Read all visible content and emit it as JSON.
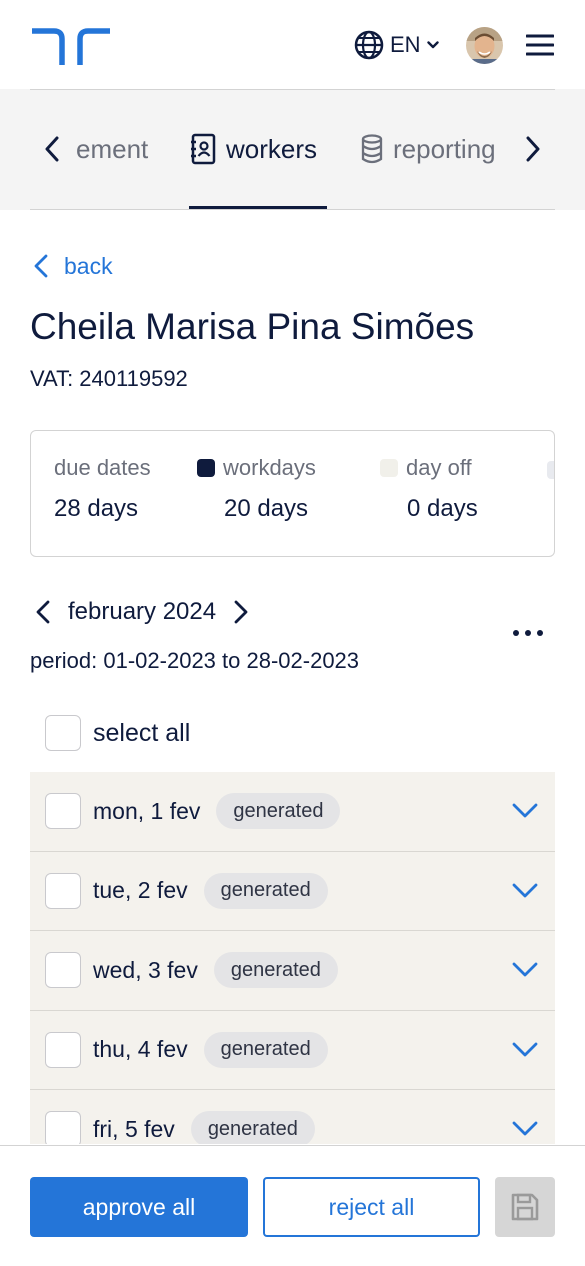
{
  "header": {
    "logo": "brand-logo",
    "language": "EN",
    "icons": {
      "globe": "globe-icon",
      "chevron": "chevron-down-icon",
      "menu": "hamburger-menu-icon"
    }
  },
  "tabs": {
    "items": [
      {
        "label": "ement",
        "icon": ""
      },
      {
        "label": "workers",
        "icon": "contacts-book-icon"
      },
      {
        "label": "reporting",
        "icon": "database-icon"
      }
    ],
    "active_index": 1
  },
  "page": {
    "back_label": "back",
    "worker_name": "Cheila Marisa Pina Simões",
    "vat": "VAT: 240119592"
  },
  "summary": {
    "items": [
      {
        "label": "due dates",
        "value": "28 days",
        "color": ""
      },
      {
        "label": "workdays",
        "value": "20 days",
        "color": "#0f1b3d"
      },
      {
        "label": "day off",
        "value": "0 days",
        "color": "#f1f0ea"
      }
    ]
  },
  "calendar": {
    "month": "february 2024",
    "period": "period: 01-02-2023 to 28-02-2023",
    "select_all_label": "select all"
  },
  "days": [
    {
      "label": "mon, 1 fev",
      "status": "generated"
    },
    {
      "label": "tue, 2 fev",
      "status": "generated"
    },
    {
      "label": "wed, 3 fev",
      "status": "generated"
    },
    {
      "label": "thu, 4 fev",
      "status": "generated"
    },
    {
      "label": "fri, 5 fev",
      "status": "generated"
    }
  ],
  "footer": {
    "approve_label": "approve all",
    "reject_label": "reject all",
    "save_icon": "floppy-disk-icon"
  },
  "colors": {
    "primary": "#2475d8",
    "navy": "#0f1b3d",
    "row_bg": "#f4f2ed",
    "badge_bg": "#e4e4e6"
  }
}
